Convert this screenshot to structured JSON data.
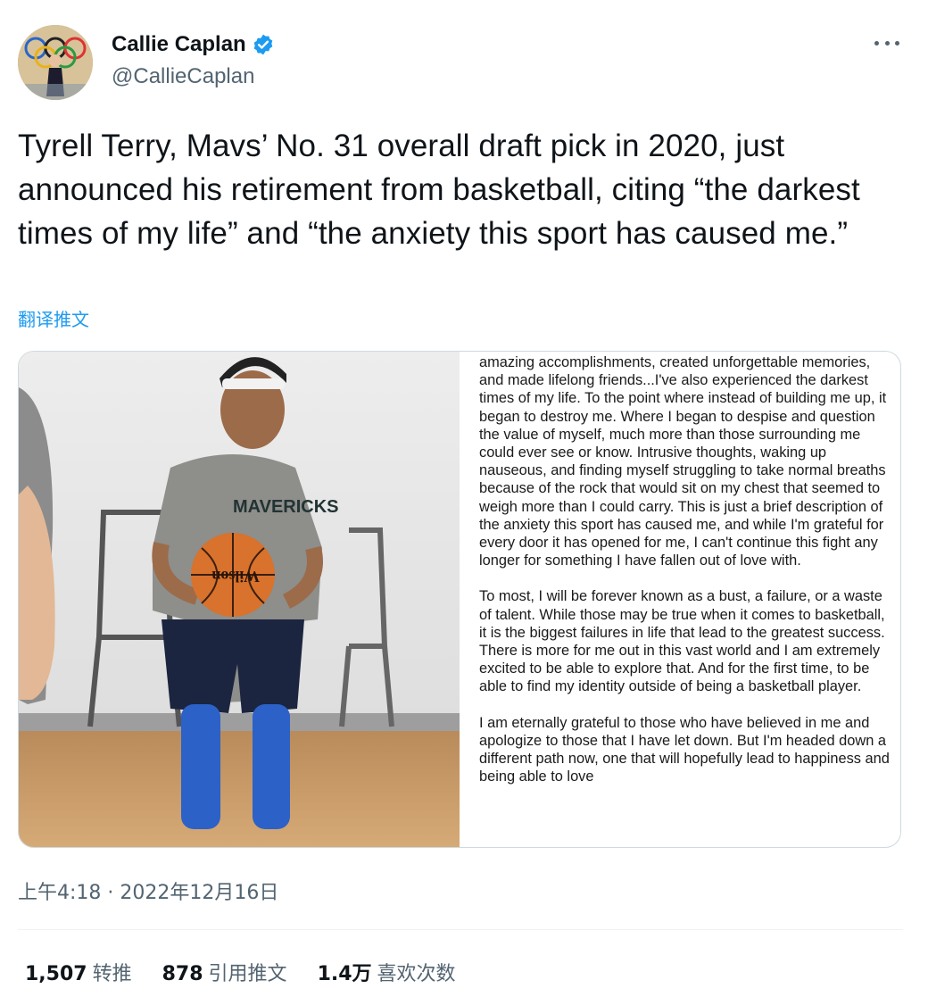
{
  "author": {
    "name": "Callie Caplan",
    "handle": "@CallieCaplan",
    "verified": true
  },
  "tweet": {
    "text": "Tyrell Terry, Mavs’ No. 31 overall draft pick in 2020, just announced his retirement from basketball, citing “the darkest times of my life” and “the anxiety this sport has caused me.”",
    "translate_label": "翻译推文"
  },
  "media": {
    "photo_icon": "basketball-player-photo",
    "jersey_text": "MAVERICKS",
    "ball_text": "Wilson",
    "statement_paragraphs": [
      "amazing accomplishments, created unforgettable memories, and made lifelong friends...I've also experienced the darkest times of my life. To the point where instead of building me up, it began to destroy me. Where I began to despise and question the value of myself, much more than those surrounding me could ever see or know. Intrusive thoughts, waking up nauseous, and finding myself struggling to take normal breaths because of the rock that would sit on my chest that seemed to weigh more than I could carry. This is just a brief description of the anxiety this sport has caused me, and while I'm grateful for every door it has opened for me, I can't continue this fight any longer for something I have fallen out of love with.",
      "To most, I will be forever known as a bust, a failure, or a waste of talent. While those may be true when it comes to basketball, it is the biggest failures in life that lead to the greatest success. There is more for me out in this vast world and I am extremely excited to be able to explore that. And for the first time, to be able to find my identity outside of being a basketball player.",
      "I am eternally grateful to those who have believed in me and apologize to those that I have let down. But I'm headed down a different path now, one that will hopefully lead to happiness and being able to love"
    ]
  },
  "timestamp": "上午4:18 · 2022年12月16日",
  "stats": [
    {
      "count": "1,507",
      "label": "转推"
    },
    {
      "count": "878",
      "label": "引用推文"
    },
    {
      "count": "1.4万",
      "label": "喜欢次数"
    }
  ],
  "colors": {
    "accent": "#1d9bf0",
    "text": "#0f1419",
    "secondary": "#536471"
  }
}
